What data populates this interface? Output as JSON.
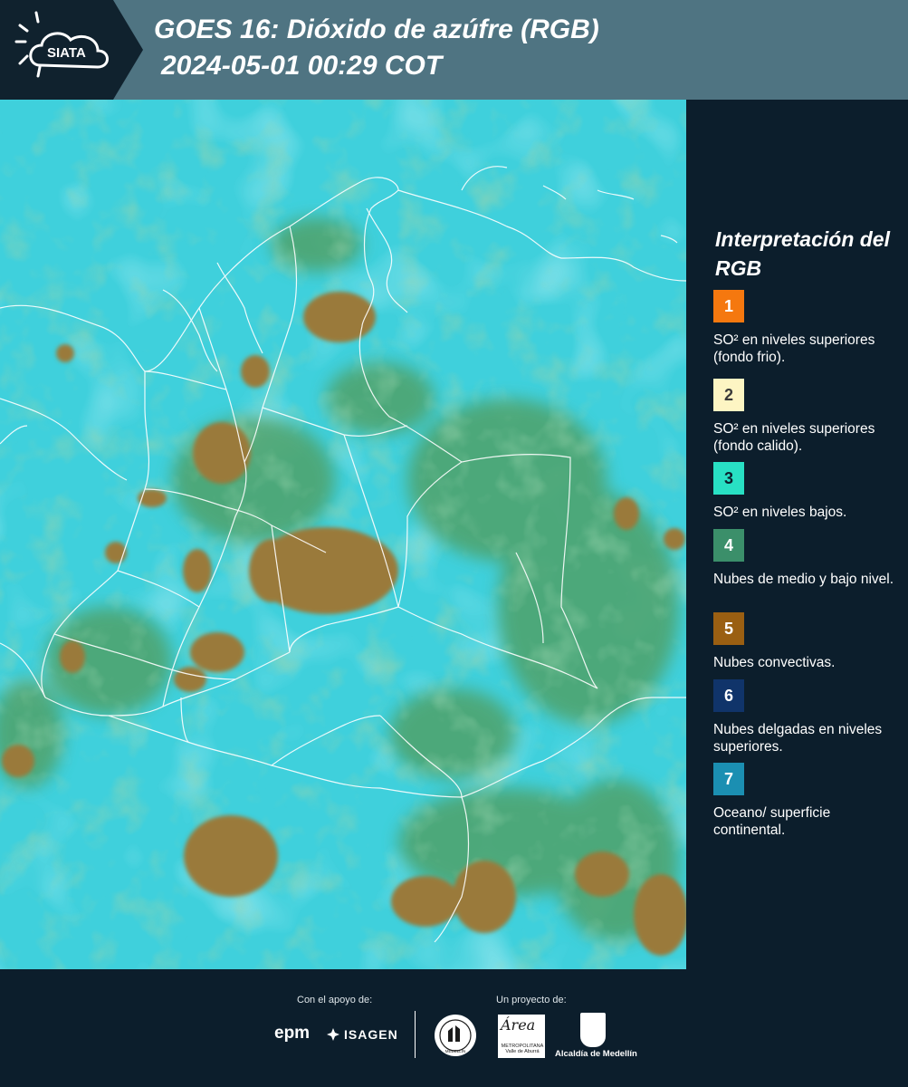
{
  "header": {
    "logo_text": "SIATA",
    "title_line1": "GOES 16: Dióxido de azúfre (RGB)",
    "title_line2": "2024-05-01 00:29 COT",
    "background_color": "#4f7482",
    "logo_panel_color": "#10222e"
  },
  "map": {
    "background_color": "#3fd0dc",
    "convective_color": "#9a7a3a",
    "vegetation_color": "#5fae72"
  },
  "legend": {
    "title": "Interpretación del RGB",
    "items": [
      {
        "number": "1",
        "color": "#f5780f",
        "text": "SO² en niveles superiores (fondo frio)."
      },
      {
        "number": "2",
        "color": "#fdf5c3",
        "text": "SO² en niveles superiores (fondo calido)."
      },
      {
        "number": "3",
        "color": "#28e0c4",
        "text": "SO² en niveles bajos."
      },
      {
        "number": "4",
        "color": "#3b8f6a",
        "text": "Nubes de medio y bajo nivel."
      },
      {
        "number": "5",
        "color": "#9a5f12",
        "text": "Nubes convectivas."
      },
      {
        "number": "6",
        "color": "#10346a",
        "text": "Nubes delgadas en niveles superiores."
      },
      {
        "number": "7",
        "color": "#1b8fb2",
        "text": "Oceano/ superficie continental."
      }
    ]
  },
  "footer": {
    "support_label": "Con el apoyo de:",
    "project_label": "Un proyecto de:",
    "sponsor_1": "epm",
    "sponsor_2": "ISAGEN",
    "partner_area": "Área",
    "partner_area_sub": "METROPOLITANA Valle de Aburrá",
    "partner_alcaldia": "Alcaldía de Medellín",
    "seal_label": "MEDELLÍN"
  }
}
